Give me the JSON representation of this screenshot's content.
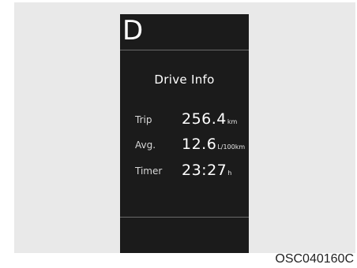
{
  "colors": {
    "background": "#e9e9e9",
    "screen": "#1b1b1b",
    "text": "#ffffff",
    "divider": "#6a6a6a"
  },
  "display": {
    "gear": "D",
    "title": "Drive Info",
    "rows": [
      {
        "label": "Trip",
        "value": "256.4",
        "unit": "km"
      },
      {
        "label": "Avg.",
        "value": "12.6",
        "unit": "L/100km"
      },
      {
        "label": "Timer",
        "value": "23:27",
        "unit": "h"
      }
    ]
  },
  "caption": "OSC040160C"
}
